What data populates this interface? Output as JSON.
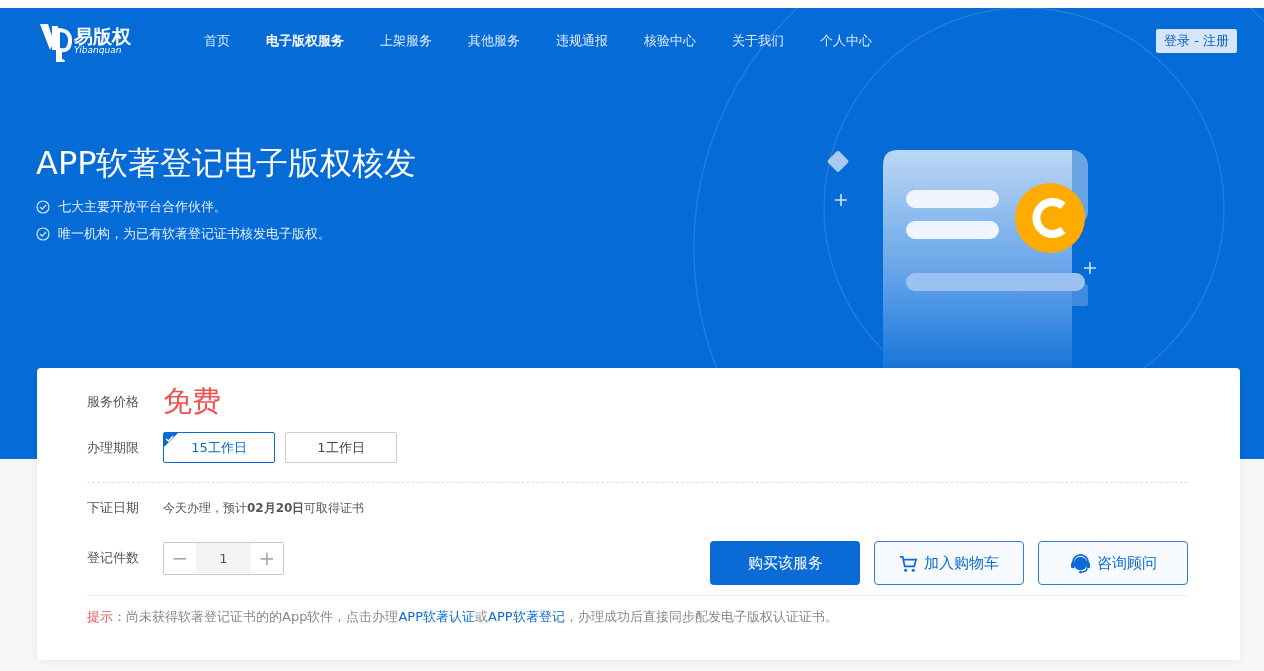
{
  "logo": {
    "mark": "易版权",
    "sub": "Yibanquan"
  },
  "nav": [
    {
      "label": "首页",
      "selected": false
    },
    {
      "label": "电子版权服务",
      "selected": true
    },
    {
      "label": "上架服务",
      "selected": false
    },
    {
      "label": "其他服务",
      "selected": false
    },
    {
      "label": "违规通报",
      "selected": false
    },
    {
      "label": "核验中心",
      "selected": false
    },
    {
      "label": "关于我们",
      "selected": false
    },
    {
      "label": "个人中心",
      "selected": false
    }
  ],
  "login": "登录 - 注册",
  "hero": {
    "title": "APP软著登记电子版权核发",
    "points": [
      "七大主要开放平台合作伙伴。",
      "唯一机构，为已有软著登记证书核发电子版权。"
    ]
  },
  "price": {
    "label": "服务价格",
    "value": "免费"
  },
  "period": {
    "label": "办理期限",
    "options": [
      {
        "label": "15工作日",
        "selected": true
      },
      {
        "label": "1工作日",
        "selected": false
      }
    ]
  },
  "date": {
    "label": "下证日期",
    "text": "今天办理，预计**02月20日**可取得证书"
  },
  "count": {
    "label": "登记件数",
    "minus": "−",
    "value": "1",
    "plus": "+"
  },
  "buttons": [
    {
      "kind": "primary",
      "label": "购买该服务"
    },
    {
      "kind": "cart",
      "label": "加入购物车"
    },
    {
      "kind": "consult",
      "label": "咨询顾问"
    }
  ],
  "tip": {
    "prefix": "提示：",
    "parts": [
      {
        "kind": "text",
        "text": "尚未获得软著登记证书的的App软件，点击办理"
      },
      {
        "kind": "link",
        "text": "APP软著认证"
      },
      {
        "kind": "text",
        "text": "或"
      },
      {
        "kind": "link",
        "text": "APP软著登记"
      },
      {
        "kind": "text",
        "text": "，办理成功后直接同步配发电子版权认证证书。"
      }
    ]
  }
}
